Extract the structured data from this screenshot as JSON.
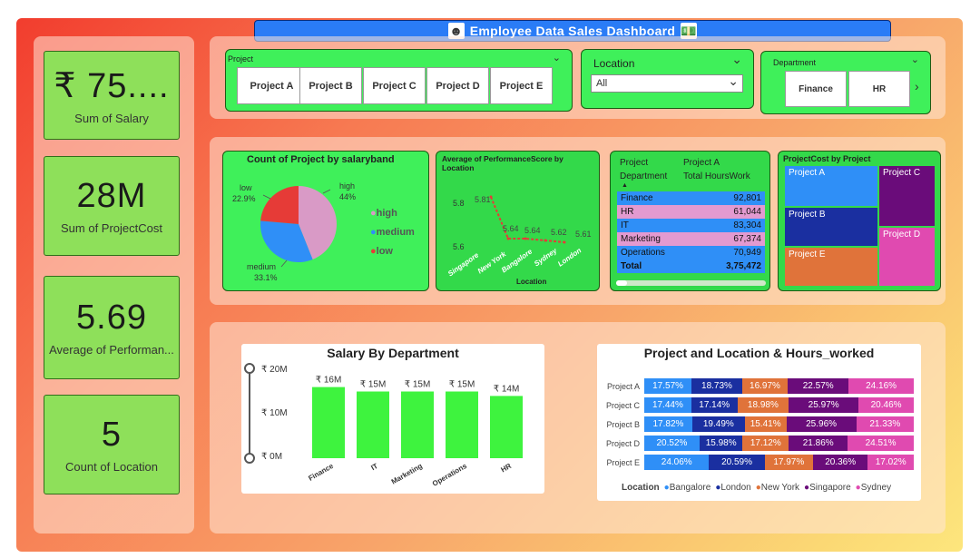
{
  "header": {
    "title": "Employee Data Sales Dashboard",
    "left_icon": "people-icon",
    "right_icon": "money-icon"
  },
  "kpis": [
    {
      "value": "₹ 75....",
      "label": "Sum of Salary"
    },
    {
      "value": "28M",
      "label": "Sum of ProjectCost"
    },
    {
      "value": "5.69",
      "label": "Average of Performan..."
    },
    {
      "value": "5",
      "label": "Count of Location"
    }
  ],
  "slicers": {
    "project": {
      "title": "Project",
      "items": [
        "Project A",
        "Project B",
        "Project C",
        "Project D",
        "Project E"
      ]
    },
    "location": {
      "title": "Location",
      "selected": "All"
    },
    "department": {
      "title": "Department",
      "items": [
        "Finance",
        "HR"
      ]
    }
  },
  "pie": {
    "title": "Count of Project by salaryband",
    "labels": {
      "high": "high",
      "high_pct": "44%",
      "low": "low",
      "low_pct": "22.9%",
      "medium": "medium",
      "medium_pct": "33.1%"
    },
    "legend": [
      "high",
      "medium",
      "low"
    ],
    "colors": {
      "high": "#d99ac6",
      "medium": "#2f8ff7",
      "low": "#e63b37"
    }
  },
  "perf": {
    "title": "Average of PerformanceScore by Location",
    "xlabel": "Location",
    "y_ticks": [
      "5.8",
      "5.6"
    ],
    "points": [
      {
        "loc": "Singapore",
        "value": "5.81"
      },
      {
        "loc": "New York",
        "value": "5.64"
      },
      {
        "loc": "Bangalore",
        "value": "5.64"
      },
      {
        "loc": "Sydney",
        "value": "5.62"
      },
      {
        "loc": "London",
        "value": "5.61"
      }
    ]
  },
  "matrix": {
    "head1": [
      "Project",
      "Project A"
    ],
    "head2": [
      "Department",
      "Total HoursWork"
    ],
    "rows": [
      {
        "dept": "Finance",
        "hours": "92,801",
        "color": "#2f8ff7"
      },
      {
        "dept": "HR",
        "hours": "61,044",
        "color": "#e39ad0"
      },
      {
        "dept": "IT",
        "hours": "83,304",
        "color": "#2f8ff7"
      },
      {
        "dept": "Marketing",
        "hours": "67,374",
        "color": "#e39ad0"
      },
      {
        "dept": "Operations",
        "hours": "70,949",
        "color": "#2f8ff7"
      }
    ],
    "total": {
      "label": "Total",
      "hours": "3,75,472"
    }
  },
  "treemap": {
    "title": "ProjectCost by Project",
    "tiles": [
      {
        "name": "Project A",
        "color": "#2f8ff7"
      },
      {
        "name": "Project B",
        "color": "#1a2fa0"
      },
      {
        "name": "Project E",
        "color": "#e0733a"
      },
      {
        "name": "Project C",
        "color": "#6a0c7a"
      },
      {
        "name": "Project D",
        "color": "#e04ab0"
      }
    ]
  },
  "chart_data": [
    {
      "type": "bar",
      "title": "Salary By Department",
      "categories": [
        "Finance",
        "IT",
        "Marketing",
        "Operations",
        "HR"
      ],
      "values": [
        16,
        15,
        15,
        15,
        14
      ],
      "data_labels": [
        "₹ 16M",
        "₹ 15M",
        "₹ 15M",
        "₹ 15M",
        "₹ 14M"
      ],
      "y_ticks": [
        "₹ 20M",
        "₹ 10M",
        "₹ 0M"
      ],
      "ylim": [
        0,
        20
      ],
      "color": "#3ef33e"
    },
    {
      "type": "bar",
      "title": "Project and Location & Hours_worked",
      "legend_title": "Location",
      "categories": [
        "Project A",
        "Project C",
        "Project B",
        "Project D",
        "Project E"
      ],
      "series": [
        {
          "name": "Bangalore",
          "color": "#2f8ff7",
          "values": [
            "17.57%",
            "17.44%",
            "17.82%",
            "20.52%",
            "24.06%"
          ]
        },
        {
          "name": "London",
          "color": "#1a2fa0",
          "values": [
            "18.73%",
            "17.14%",
            "19.49%",
            "15.98%",
            "20.59%"
          ]
        },
        {
          "name": "New York",
          "color": "#e0733a",
          "values": [
            "16.97%",
            "18.98%",
            "15.41%",
            "17.12%",
            "17.97%"
          ]
        },
        {
          "name": "Singapore",
          "color": "#6a0c7a",
          "values": [
            "22.57%",
            "25.97%",
            "25.96%",
            "21.86%",
            "20.36%"
          ]
        },
        {
          "name": "Sydney",
          "color": "#e04ab0",
          "values": [
            "24.16%",
            "20.46%",
            "21.33%",
            "24.51%",
            "17.02%"
          ]
        }
      ]
    }
  ]
}
